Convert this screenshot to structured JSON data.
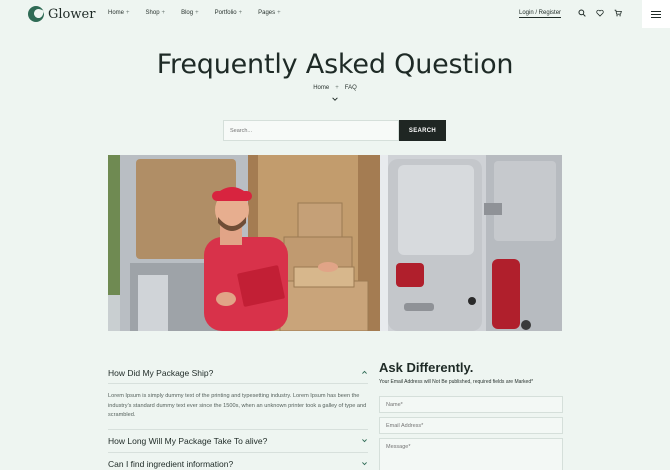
{
  "brand": {
    "name": "Glower"
  },
  "nav": {
    "items": [
      {
        "label": "Home"
      },
      {
        "label": "Shop"
      },
      {
        "label": "Blog"
      },
      {
        "label": "Portfolio"
      },
      {
        "label": "Pages"
      }
    ],
    "login_label": "Login / Register"
  },
  "icons": [
    "search-icon",
    "heart-icon",
    "cart-icon",
    "hamburger-menu-icon",
    "chevron-down-icon",
    "chevron-up-icon"
  ],
  "hero": {
    "title": "Frequently Asked Question",
    "breadcrumb": {
      "home": "Home",
      "current": "FAQ"
    }
  },
  "search": {
    "placeholder": "Search...",
    "button_label": "SEARCH"
  },
  "faq": {
    "items": [
      {
        "question": "How Did My Package Ship?",
        "answer": "Lorem Ipsum is simply dummy text of the printing and typesetting industry. Lorem Ipsum has been the industry's standard dummy text ever since the 1500s, when an unknown printer took a galley of type and scrambled.",
        "open": true
      },
      {
        "question": "How Long Will My Package Take To alive?",
        "open": false
      },
      {
        "question": "Can I find ingredient information?",
        "open": false
      }
    ]
  },
  "contact_form": {
    "title": "Ask Differently.",
    "note": "Your Email Address will Not Be published, required fields are Marked*",
    "name_placeholder": "Name*",
    "email_placeholder": "Email Address*",
    "message_placeholder": "Message*"
  },
  "colors": {
    "page_bg": "#eef5f1",
    "brand_green": "#2f6b55",
    "dark_button": "#1f2623"
  }
}
